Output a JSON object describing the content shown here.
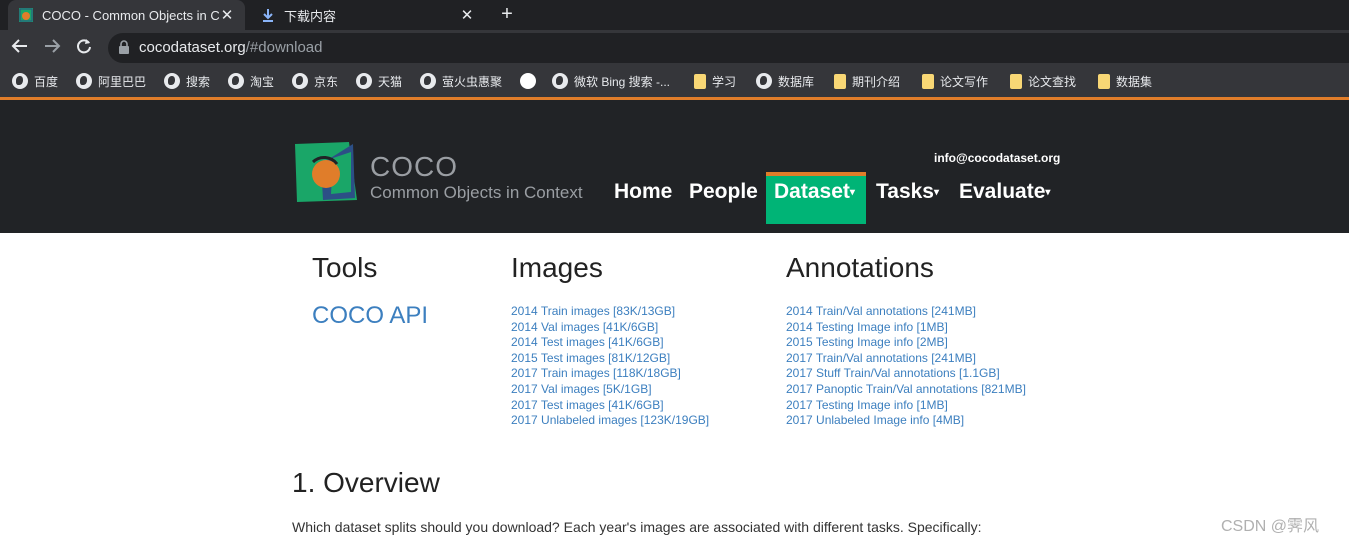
{
  "browser": {
    "tabs": [
      {
        "title": "COCO - Common Objects in C",
        "active": true
      },
      {
        "title": "下载内容",
        "active": false
      }
    ],
    "url_host": "cocodataset.org",
    "url_path": "/#download",
    "bookmarks": [
      {
        "label": "百度",
        "icon": "globe-icon"
      },
      {
        "label": "阿里巴巴",
        "icon": "globe-icon"
      },
      {
        "label": "搜索",
        "icon": "globe-icon"
      },
      {
        "label": "淘宝",
        "icon": "globe-icon"
      },
      {
        "label": "京东",
        "icon": "globe-icon"
      },
      {
        "label": "天猫",
        "icon": "globe-icon"
      },
      {
        "label": "萤火虫惠聚",
        "icon": "globe-icon"
      },
      {
        "label": "",
        "icon": "circle-icon"
      },
      {
        "label": "微软 Bing 搜索 -...",
        "icon": "globe-icon"
      },
      {
        "label": "学习",
        "icon": "folder-icon"
      },
      {
        "label": "数据库",
        "icon": "database-icon"
      },
      {
        "label": "期刊介绍",
        "icon": "folder-icon"
      },
      {
        "label": "论文写作",
        "icon": "folder-icon"
      },
      {
        "label": "论文查找",
        "icon": "folder-icon"
      },
      {
        "label": "数据集",
        "icon": "folder-icon"
      }
    ]
  },
  "site": {
    "logo_name": "COCO",
    "logo_sub": "Common Objects in Context",
    "contact": "info@cocodataset.org",
    "nav": [
      {
        "label": "Home",
        "dropdown": false
      },
      {
        "label": "People",
        "dropdown": false
      },
      {
        "label": "Dataset",
        "dropdown": true,
        "active": true
      },
      {
        "label": "Tasks",
        "dropdown": true
      },
      {
        "label": "Evaluate",
        "dropdown": true
      }
    ],
    "colors": {
      "header_bg": "#212326",
      "active_nav": "#00b476",
      "accent": "#e07d2a",
      "link": "#3c7fbf"
    }
  },
  "content": {
    "tools_heading": "Tools",
    "images_heading": "Images",
    "annotations_heading": "Annotations",
    "tools": [
      "COCO API"
    ],
    "images": [
      "2014 Train images [83K/13GB]",
      "2014 Val images [41K/6GB]",
      "2014 Test images [41K/6GB]",
      "2015 Test images [81K/12GB]",
      "2017 Train images [118K/18GB]",
      "2017 Val images [5K/1GB]",
      "2017 Test images [41K/6GB]",
      "2017 Unlabeled images [123K/19GB]"
    ],
    "annotations": [
      "2014 Train/Val annotations [241MB]",
      "2014 Testing Image info [1MB]",
      "2015 Testing Image info [2MB]",
      "2017 Train/Val annotations [241MB]",
      "2017 Stuff Train/Val annotations [1.1GB]",
      "2017 Panoptic Train/Val annotations [821MB]",
      "2017 Testing Image info [1MB]",
      "2017 Unlabeled Image info [4MB]"
    ],
    "overview_heading": "1. Overview",
    "overview_text": "Which dataset splits should you download? Each year's images are associated with different tasks. Specifically:"
  },
  "watermark": "CSDN @霁风"
}
